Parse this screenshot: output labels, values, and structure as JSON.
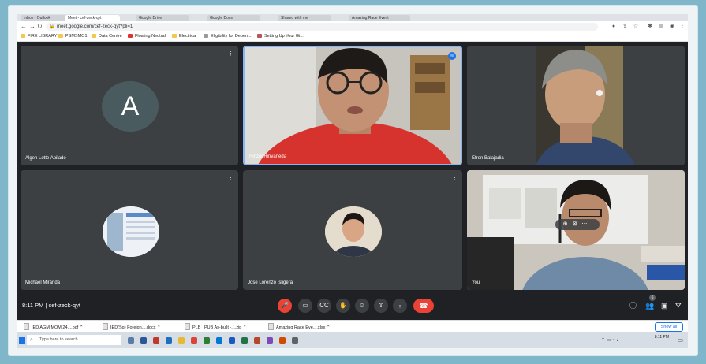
{
  "browser": {
    "tabs": [
      "Inbox - Outlook",
      "Meet - cef-zeck-qyt",
      "Google Drive",
      "Google Docs",
      "Shared with me",
      "Amazing Race Event"
    ],
    "url": "meet.google.com/cef-zeck-qyt?pli=1",
    "bookmarks": [
      "FIRE LIBRARY",
      "PSMSMO1",
      "Data Centre",
      "Floating Neutral",
      "Electrical",
      "Eligibility for Depen...",
      "Setting Up Your Gi..."
    ]
  },
  "participants": [
    {
      "name": "Algen Lotte Apilado",
      "initial": "A"
    },
    {
      "name": "Rinzel Rinvaneda"
    },
    {
      "name": "Efren Balajadia"
    },
    {
      "name": "Michael Miranda"
    },
    {
      "name": "Jose Lorenzo Isligera"
    },
    {
      "name": "You"
    }
  ],
  "controls": {
    "time": "8:11 PM",
    "meeting_code": "cef-zeck-qyt",
    "people_count": "6"
  },
  "downloads": {
    "items": [
      "IED AGM MOM 24....pdf",
      "IED(Sg) Foreign....docx",
      "PLB_IPUB As-built -....zip",
      "Amazing Race Eve....xlsx"
    ],
    "show_all": "Show all"
  },
  "taskbar": {
    "search_placeholder": "Type here to search",
    "time": "8:11 PM"
  }
}
